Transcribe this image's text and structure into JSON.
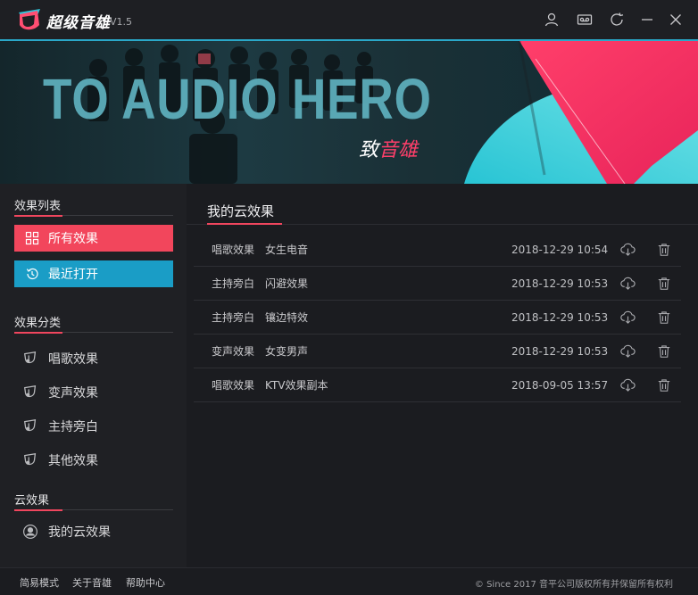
{
  "titlebar": {
    "app_name": "超级音雄",
    "version": "V1.5",
    "buttons": [
      "user-icon",
      "device-icon",
      "refresh-icon",
      "minimize-icon",
      "close-icon"
    ]
  },
  "banner": {
    "title": "TO AUDIO HERO",
    "subtitle_prefix": "致",
    "subtitle_accent": "音雄"
  },
  "sidebar": {
    "effects_list_title": "效果列表",
    "all_effects_label": "所有效果",
    "recent_label": "最近打开",
    "category_title": "效果分类",
    "categories": [
      {
        "label": "唱歌效果",
        "icon": "music-icon"
      },
      {
        "label": "变声效果",
        "icon": "music-icon"
      },
      {
        "label": "主持旁白",
        "icon": "music-icon"
      },
      {
        "label": "其他效果",
        "icon": "music-icon"
      }
    ],
    "cloud_title": "云效果",
    "my_cloud_label": "我的云效果"
  },
  "main": {
    "title": "我的云效果",
    "rows": [
      {
        "category": "唱歌效果",
        "name": "女生电音",
        "time": "2018-12-29 10:54"
      },
      {
        "category": "主持旁白",
        "name": "闪避效果",
        "time": "2018-12-29 10:53"
      },
      {
        "category": "主持旁白",
        "name": "镶边特效",
        "time": "2018-12-29 10:53"
      },
      {
        "category": "变声效果",
        "name": "女变男声",
        "time": "2018-12-29 10:53"
      },
      {
        "category": "唱歌效果",
        "name": "KTV效果副本",
        "time": "2018-09-05 13:57"
      }
    ]
  },
  "footer": {
    "simple_mode": "简易模式",
    "about": "关于音雄",
    "help": "帮助中心",
    "copyright": "© Since 2017 音平公司版权所有并保留所有权利"
  },
  "colors": {
    "accent_red": "#f2465c",
    "accent_blue": "#1a9dc6",
    "background": "#1d1e22"
  }
}
